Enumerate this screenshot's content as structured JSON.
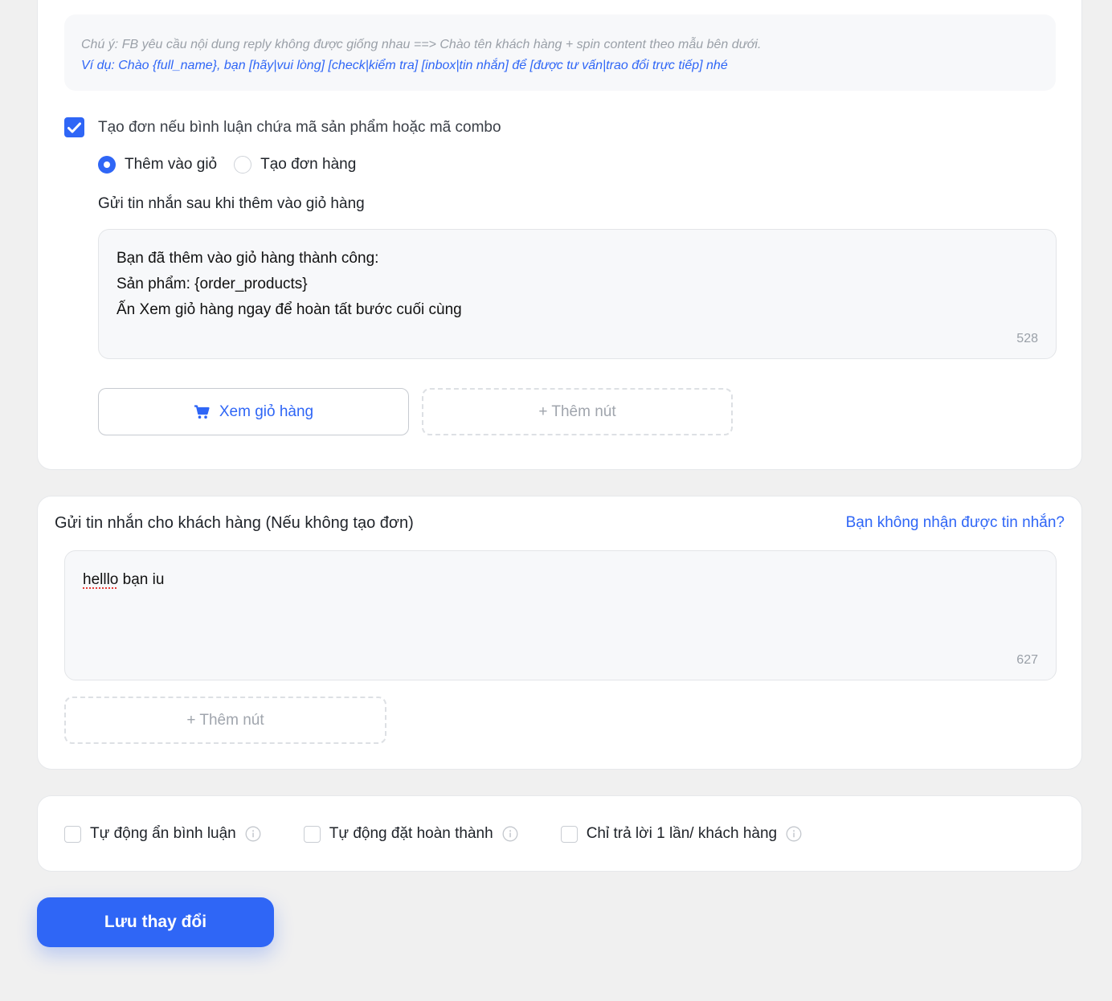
{
  "note": {
    "warning": "Chú ý: FB yêu cầu nội dung reply không được giống nhau ==> Chào tên khách hàng + spin content theo mẫu bên dưới.",
    "example": "Ví dụ: Chào {full_name}, bạn [hãy|vui lòng] [check|kiểm tra] [inbox|tin nhắn] để [được tư vấn|trao đổi trực tiếp] nhé"
  },
  "order_option": {
    "checked": true,
    "label": "Tạo đơn nếu bình luận chứa mã sản phẩm hoặc mã combo",
    "radios": [
      {
        "label": "Thêm vào giỏ",
        "selected": true
      },
      {
        "label": "Tạo đơn hàng",
        "selected": false
      }
    ],
    "message_label": "Gửi tin nhắn sau khi thêm vào giỏ hàng",
    "message_lines": [
      "Bạn đã thêm vào giỏ hàng thành công:",
      "Sản phẩm: {order_products}",
      "Ấn Xem giỏ hàng ngay để hoàn tất bước cuối cùng"
    ],
    "message_counter": "528",
    "view_cart_label": "Xem giỏ hàng",
    "add_button_label": "+ Thêm nút"
  },
  "customer_message": {
    "title": "Gửi tin nhắn cho khách hàng (Nếu không tạo đơn)",
    "help_link": "Bạn không nhận được tin nhắn?",
    "misspelled_word": "helllo",
    "text_rest": " bạn iu",
    "counter": "627",
    "add_button_label": "+ Thêm nút"
  },
  "options": [
    {
      "label": "Tự động ẩn bình luận",
      "checked": false
    },
    {
      "label": "Tự động đặt hoàn thành",
      "checked": false
    },
    {
      "label": "Chỉ trả lời 1 lần/ khách hàng",
      "checked": false
    }
  ],
  "save_label": "Lưu thay đổi",
  "colors": {
    "accent": "#2f66f6",
    "muted": "#9aa0a8",
    "background": "#f0f0f0"
  },
  "icons": {
    "cart": "cart-icon",
    "info": "info-icon",
    "check": "check-icon"
  }
}
